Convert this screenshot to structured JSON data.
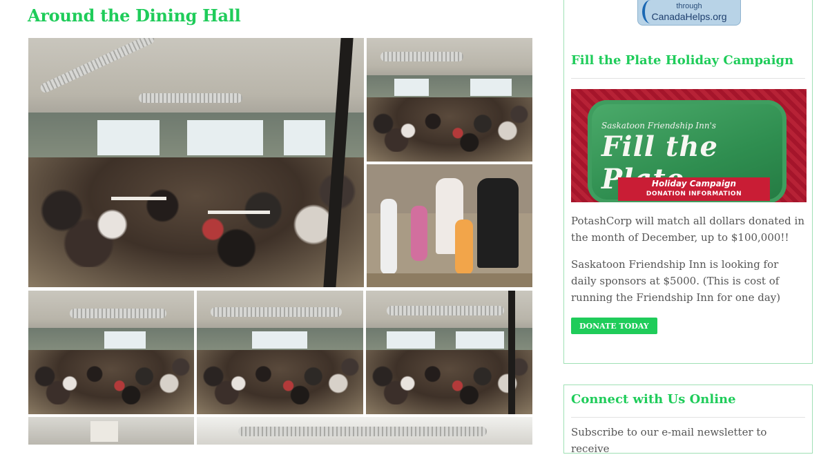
{
  "main": {
    "section_title": "Around the Dining Hall"
  },
  "sidebar": {
    "badge": {
      "through": "through",
      "org": "CanadaHelps.org"
    },
    "campaign": {
      "title": "Fill the Plate Holiday Campaign",
      "banner": {
        "top_text": "Saskatoon Friendship Inn's",
        "main_text": "Fill the Plate",
        "ribbon_line1": "Holiday Campaign",
        "ribbon_line2": "DONATION INFORMATION"
      },
      "paragraph1": "PotashCorp will match all dollars donated in the month of December, up to $100,000!!",
      "paragraph2": "Saskatoon Friendship Inn is looking for daily sponsors at $5000. (This is cost of running the Friendship Inn for one day)",
      "donate_label": "DONATE TODAY"
    },
    "connect": {
      "title": "Connect with Us Online",
      "text": "Subscribe to our e-mail newsletter to receive"
    }
  },
  "colors": {
    "accent": "#1fcc5a",
    "border": "#9fe0b4",
    "text": "#555555"
  }
}
